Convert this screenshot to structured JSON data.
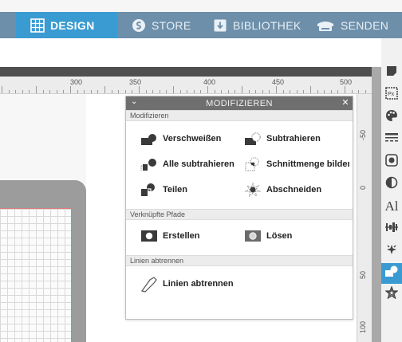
{
  "tabs": [
    {
      "label": "DESIGN",
      "active": true,
      "icon": "grid-icon"
    },
    {
      "label": "STORE",
      "active": false,
      "icon": "store-icon"
    },
    {
      "label": "BIBLIOTHEK",
      "active": false,
      "icon": "library-download-icon"
    },
    {
      "label": "SENDEN",
      "active": false,
      "icon": "send-machine-icon"
    }
  ],
  "ruler": {
    "top_labels": [
      "300",
      "350",
      "400",
      "450",
      "500"
    ],
    "right_labels": [
      "-50",
      "0",
      "50",
      "100"
    ]
  },
  "panel": {
    "title": "MODIFIZIEREN",
    "sections": {
      "modify": {
        "title": "Modifizieren",
        "buttons": {
          "weld": "Verschweißen",
          "subtract": "Subtrahieren",
          "subtract_all": "Alle subtrahieren",
          "intersect": "Schnittmenge bilden",
          "divide": "Teilen",
          "crop": "Abschneiden"
        }
      },
      "compound": {
        "title": "Verknüpfte Pfade",
        "buttons": {
          "make": "Erstellen",
          "release": "Lösen"
        }
      },
      "detach": {
        "title": "Linien abtrennen",
        "buttons": {
          "detach": "Linien abtrennen"
        }
      }
    }
  },
  "right_tools": [
    {
      "icon": "page-setup-icon",
      "active": false
    },
    {
      "icon": "pixscan-icon",
      "active": false
    },
    {
      "icon": "fill-palette-icon",
      "active": false
    },
    {
      "icon": "line-style-icon",
      "active": false
    },
    {
      "icon": "image-effects-icon",
      "active": false
    },
    {
      "icon": "contrast-icon",
      "active": false
    },
    {
      "icon": "text-style-icon",
      "text": "Al",
      "active": false
    },
    {
      "icon": "align-icon",
      "active": false
    },
    {
      "icon": "replicate-icon",
      "active": false
    },
    {
      "icon": "modify-icon",
      "active": true
    },
    {
      "icon": "offset-star-icon",
      "active": false
    }
  ],
  "colors": {
    "tab_bar": "#6d8faa",
    "active_tab": "#3a9bd2",
    "panel_header": "#6f6f6f",
    "shape_fill": "#3a3a3a"
  }
}
